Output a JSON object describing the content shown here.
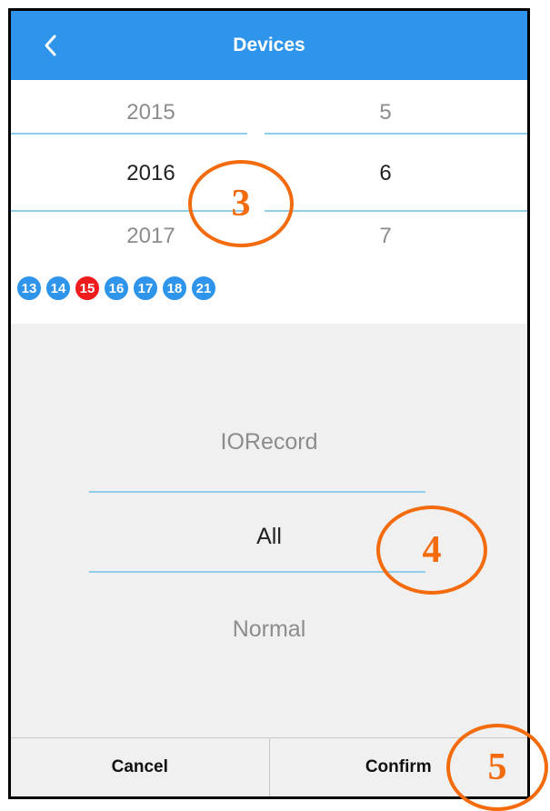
{
  "header": {
    "title": "Devices",
    "back_icon": "chevron-left-icon"
  },
  "date_picker": {
    "years": [
      "2015",
      "2016",
      "2017"
    ],
    "selected_year": "2016",
    "months": [
      "5",
      "6",
      "7"
    ],
    "selected_month": "6"
  },
  "day_chips": [
    {
      "label": "13",
      "active": false
    },
    {
      "label": "14",
      "active": false
    },
    {
      "label": "15",
      "active": true
    },
    {
      "label": "16",
      "active": false
    },
    {
      "label": "17",
      "active": false
    },
    {
      "label": "18",
      "active": false
    },
    {
      "label": "21",
      "active": false
    }
  ],
  "type_picker": {
    "options": [
      "IORecord",
      "All",
      "Normal"
    ],
    "selected": "All"
  },
  "footer": {
    "cancel_label": "Cancel",
    "confirm_label": "Confirm"
  },
  "callouts": [
    "3",
    "4",
    "5"
  ],
  "colors": {
    "header": "#2f95ea",
    "chip": "#2f95ea",
    "chip_active": "#ee1c1c",
    "callout": "#f46b0d",
    "divider": "#8fcdea"
  }
}
